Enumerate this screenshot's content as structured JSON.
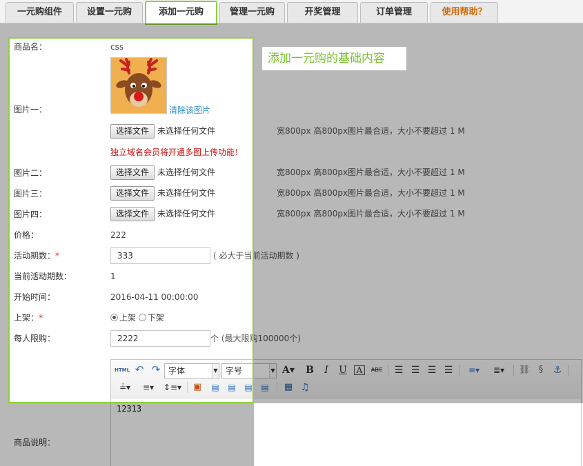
{
  "tabs": [
    {
      "label": "一元购组件"
    },
    {
      "label": "设置一元购"
    },
    {
      "label": "添加一元购"
    },
    {
      "label": "管理一元购"
    },
    {
      "label": "开奖管理"
    },
    {
      "label": "订单管理"
    },
    {
      "label": "使用帮助？"
    }
  ],
  "form": {
    "name_label": "商品名：",
    "name_value": "css",
    "image1_label": "图片一：",
    "clear_image": "清除该图片",
    "file_button": "选择文件",
    "file_none": "未选择任何文件",
    "file_hint": "宽800px 高800px图片最合适，大小不要超过 1 M",
    "upload_warning": "独立域名会员将开通多图上传功能！",
    "image2_label": "图片二：",
    "image3_label": "图片三：",
    "image4_label": "图片四：",
    "price_label": "价格：",
    "price_value": "222",
    "period_label": "活动期数：",
    "period_value": "333",
    "period_note": "( 必大于当前活动期数 )",
    "current_period_label": "当前活动期数：",
    "current_period_value": "1",
    "start_label": "开始时间：",
    "start_value": "2016-04-11 00:00:00",
    "shelf_label": "上架：",
    "shelf_on": "上架",
    "shelf_off": "下架",
    "limit_label": "每人限购：",
    "limit_value": "2222",
    "limit_note": "个 (最大限购100000个)",
    "desc_label": "商品说明：",
    "required_mark": "*"
  },
  "editor": {
    "html_btn": "HTML",
    "font_select": "字体",
    "size_select": "字号",
    "content": "12313"
  },
  "callout": {
    "text": "添加一元购的基础内容"
  },
  "colors": {
    "accent_green": "#8fd03c",
    "link_blue": "#2a8bc1",
    "warning_red": "#d01010",
    "help_orange": "#d26a0a"
  }
}
